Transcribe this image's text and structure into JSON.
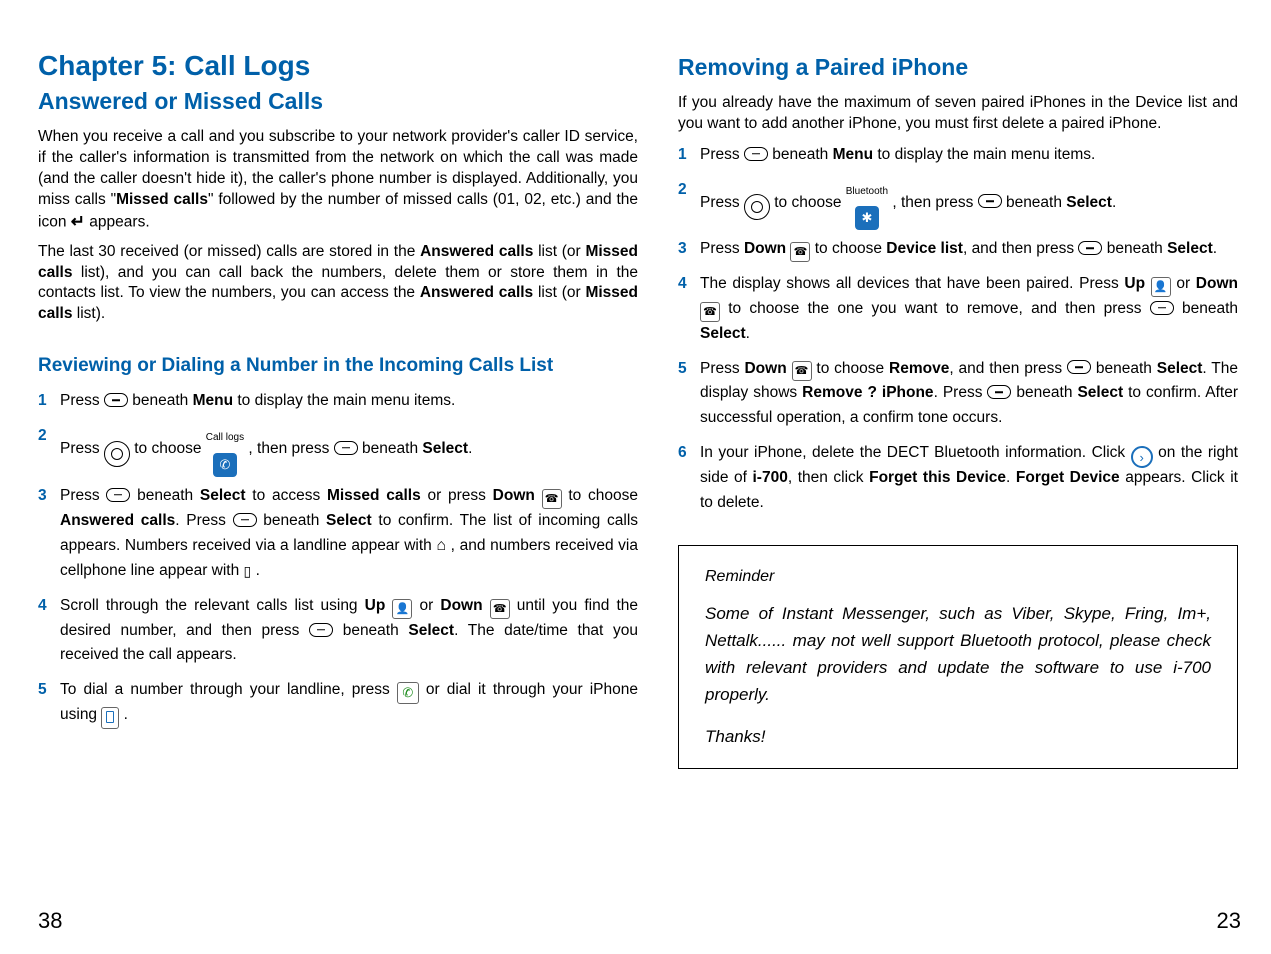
{
  "left": {
    "chapter": "Chapter 5: Call Logs",
    "section": "Answered or Missed Calls",
    "para1_a": "When you receive a call and you subscribe to your network provider's caller ID service, if the caller's information is transmitted from the network on which the call was made (and the caller doesn't hide it), the caller's phone number is displayed. Additionally, you miss calls \"",
    "para1_b": "Missed calls",
    "para1_c": "\" followed by the number of missed calls (01, 02, etc.) and the icon ",
    "para1_d": " appears.",
    "para2_a": "The last 30 received (or missed) calls are stored in the ",
    "para2_b": "Answered calls",
    "para2_c": " list (or ",
    "para2_d": "Missed calls",
    "para2_e": " list), and you can call back the numbers, delete them or store them in the contacts list. To view the numbers, you can access the ",
    "para2_f": "Answered calls",
    "para2_g": " list (or ",
    "para2_h": "Missed calls",
    "para2_i": " list).",
    "subsection": "Reviewing or Dialing a Number in the Incoming Calls List",
    "steps": {
      "s1_a": "Press ",
      "s1_b": " beneath ",
      "s1_menu": "Menu",
      "s1_c": " to display the main menu items.",
      "s2_a": "Press ",
      "s2_b": " to choose ",
      "s2_label": "Call logs",
      "s2_c": " , then press ",
      "s2_d": " beneath ",
      "s2_select": "Select",
      "s2_e": ".",
      "s3_a": "Press ",
      "s3_b": " beneath ",
      "s3_select1": "Select",
      "s3_c": " to access ",
      "s3_missed": "Missed calls",
      "s3_d": " or press ",
      "s3_down": "Down",
      "s3_e": " to choose ",
      "s3_answered": "Answered calls",
      "s3_f": ". Press ",
      "s3_g": " beneath ",
      "s3_select2": "Select",
      "s3_h": " to confirm. The list of incoming calls appears. Numbers received via a landline appear with ",
      "s3_i": " , and numbers received via cellphone line appear with ",
      "s3_j": " .",
      "s4_a": "Scroll through the relevant calls list using ",
      "s4_up": "Up",
      "s4_b": " or ",
      "s4_down": "Down",
      "s4_c": " until you find the desired number, and then press ",
      "s4_d": " beneath ",
      "s4_select": "Select",
      "s4_e": ". The date/time that you received the call appears.",
      "s5_a": "To dial a number through your landline, press ",
      "s5_b": " or dial it through your iPhone using ",
      "s5_c": " ."
    },
    "pagenum": "38"
  },
  "right": {
    "section": "Removing a Paired iPhone",
    "intro": "If you already have the maximum of seven paired iPhones in the Device list and you want to add another iPhone, you must first delete a paired iPhone.",
    "steps": {
      "s1_a": "Press ",
      "s1_b": " beneath ",
      "s1_menu": "Menu",
      "s1_c": " to display the main menu items.",
      "s2_a": "Press ",
      "s2_b": " to choose ",
      "s2_label": "Bluetooth",
      "s2_c": " , then press ",
      "s2_d": " beneath ",
      "s2_select": "Select",
      "s2_e": ".",
      "s3_a": "Press ",
      "s3_down": "Down",
      "s3_b": " to choose ",
      "s3_dl": "Device list",
      "s3_c": ", and then press ",
      "s3_d": " beneath ",
      "s3_select": "Select",
      "s3_e": ".",
      "s4_a": "The display shows all devices that have been paired. Press ",
      "s4_up": "Up",
      "s4_b": " or ",
      "s4_down": "Down",
      "s4_c": " to choose the one you want to remove, and then press ",
      "s4_d": " beneath ",
      "s4_select": "Select",
      "s4_e": ".",
      "s5_a": "Press ",
      "s5_down": "Down",
      "s5_b": " to choose ",
      "s5_remove": "Remove",
      "s5_c": ", and then press ",
      "s5_d": " beneath ",
      "s5_select1": "Select",
      "s5_e": ". The display shows ",
      "s5_rq": "Remove ? iPhone",
      "s5_f": ". Press ",
      "s5_g": " beneath ",
      "s5_select2": "Select",
      "s5_h": " to confirm. After successful operation, a confirm tone occurs.",
      "s6_a": "In your iPhone, delete the DECT Bluetooth information. Click ",
      "s6_b": " on the right side of ",
      "s6_i700": "i-700",
      "s6_c": ", then click ",
      "s6_ftd": "Forget this Device",
      "s6_d": ". ",
      "s6_fd": "Forget Device",
      "s6_e": " appears. Click it to delete."
    },
    "reminder": {
      "title": "Reminder",
      "body": "Some of Instant Messenger, such as Viber, Skype, Fring, Im+, Nettalk...... may not well support Bluetooth protocol, please check with relevant providers and update the software to use i-700 properly.",
      "thanks": "Thanks!"
    },
    "pagenum": "23"
  },
  "nums": {
    "n1": "1",
    "n2": "2",
    "n3": "3",
    "n4": "4",
    "n5": "5",
    "n6": "6"
  }
}
